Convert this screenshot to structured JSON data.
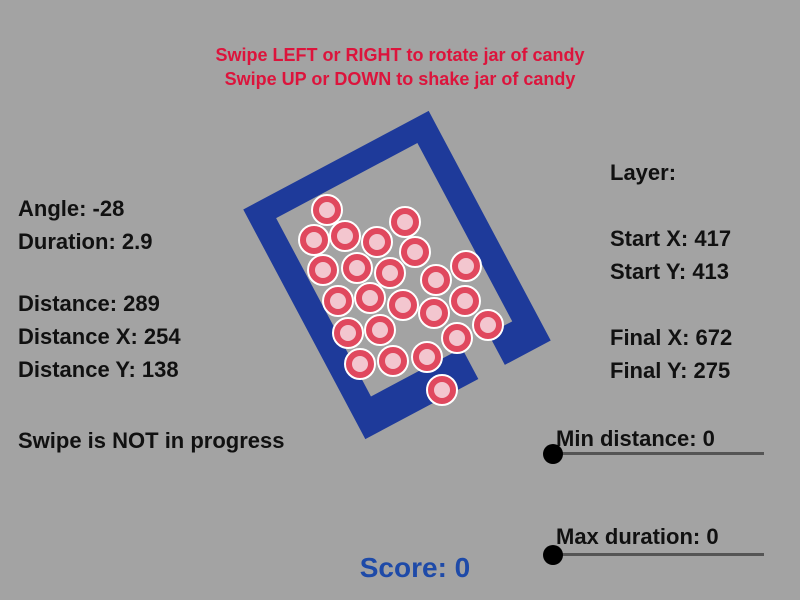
{
  "instructions": {
    "line1": "Swipe LEFT or RIGHT to rotate jar of candy",
    "line2": "Swipe UP or DOWN to shake jar of candy"
  },
  "left_stats": {
    "angle": "Angle: -28",
    "duration": "Duration: 2.9",
    "distance": "Distance: 289",
    "distance_x": "Distance X: 254",
    "distance_y": "Distance Y: 138",
    "swipe_status": "Swipe is NOT in progress"
  },
  "right_stats": {
    "layer": "Layer:",
    "start_x": "Start X: 417",
    "start_y": "Start Y: 413",
    "final_x": "Final X: 672",
    "final_y": "Final Y: 275"
  },
  "sliders": {
    "min_distance_label": "Min distance: 0",
    "min_distance_value": 0,
    "max_duration_label": "Max duration: 0",
    "max_duration_value": 0
  },
  "score": "Score: 0",
  "jar": {
    "rotation_deg": -28,
    "candy_count": 27
  },
  "colors": {
    "background": "#a3a3a3",
    "jar": "#1e3a9a",
    "instructions": "#dc143c",
    "score": "#1e4aa8",
    "candy": "#e0485e"
  }
}
